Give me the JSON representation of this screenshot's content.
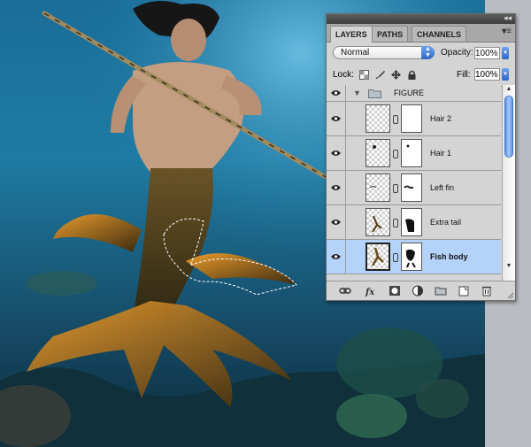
{
  "canvas": {
    "description_icon": "photo-canvas"
  },
  "panel": {
    "tabs": [
      {
        "label": "LAYERS",
        "active": true
      },
      {
        "label": "PATHS",
        "active": false
      },
      {
        "label": "CHANNELS",
        "active": false
      }
    ],
    "blend_mode": "Normal",
    "opacity_label": "Opacity:",
    "opacity_value": "100%",
    "lock_label": "Lock:",
    "fill_label": "Fill:",
    "fill_value": "100%",
    "group": {
      "name": "FIGURE",
      "icon": "folder-icon"
    },
    "layers": [
      {
        "name": "Hair 2",
        "selected": false
      },
      {
        "name": "Hair 1",
        "selected": false
      },
      {
        "name": "Left fin",
        "selected": false
      },
      {
        "name": "Extra tail",
        "selected": false
      },
      {
        "name": "Fish body",
        "selected": true
      }
    ],
    "footer_icons": [
      "link-icon",
      "fx-icon",
      "mask-icon",
      "adjustment-icon",
      "group-folder-icon",
      "new-layer-icon",
      "trash-icon"
    ],
    "colors": {
      "selected_row": "#b4d2fa",
      "accent": "#2d68c8"
    }
  }
}
